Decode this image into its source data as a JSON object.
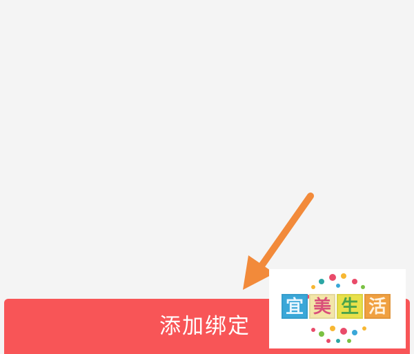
{
  "bind_button": {
    "label": "添加绑定"
  },
  "colors": {
    "background": "#f4f4f4",
    "button": "#f85557",
    "arrow": "#f28a3a"
  },
  "watermark": {
    "text": "宜美生活",
    "chars": [
      {
        "char": "宜",
        "bg": "#3aa7d8",
        "fg": "#e8f6ff"
      },
      {
        "char": "美",
        "bg": "#f3e6a8",
        "fg": "#d94f7a"
      },
      {
        "char": "生",
        "bg": "#e8e04a",
        "fg": "#4aa34a"
      },
      {
        "char": "活",
        "bg": "#f0a040",
        "fg": "#fff3e0"
      }
    ]
  }
}
